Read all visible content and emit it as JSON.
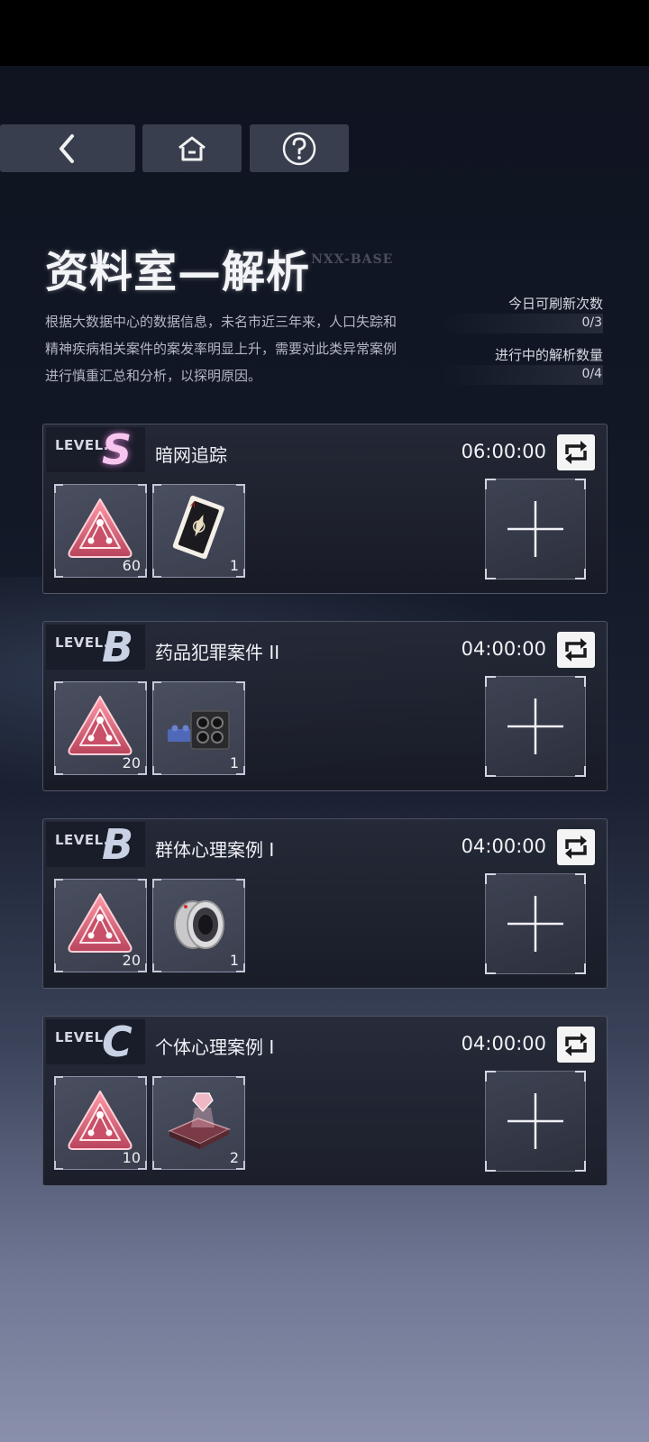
{
  "header": {
    "back_icon": "chevron-left-icon",
    "home_icon": "home-icon",
    "help_icon": "question-icon"
  },
  "page": {
    "title": "资料室—解析",
    "tag": "NXX-BASE",
    "description": "根据大数据中心的数据信息，未名市近三年来，人口失踪和精神疾病相关案件的案发率明显上升，需要对此类异常案例进行慎重汇总和分析，以探明原因。"
  },
  "stats": {
    "refresh_label": "今日可刷新次数",
    "refresh_value": "0/3",
    "active_label": "进行中的解析数量",
    "active_value": "0/4"
  },
  "cases": [
    {
      "level_word": "LEVEL.",
      "level": "S",
      "name": "暗网追踪",
      "time": "06:00:00",
      "items": [
        {
          "icon": "pink-triangle-token-icon",
          "count": "60"
        },
        {
          "icon": "playing-card-icon",
          "count": "1"
        }
      ]
    },
    {
      "level_word": "LEVEL.",
      "level": "B",
      "name": "药品犯罪案件 II",
      "time": "04:00:00",
      "items": [
        {
          "icon": "pink-triangle-token-icon",
          "count": "20"
        },
        {
          "icon": "building-block-icon",
          "count": "1"
        }
      ]
    },
    {
      "level_word": "LEVEL.",
      "level": "B",
      "name": "群体心理案例 I",
      "time": "04:00:00",
      "items": [
        {
          "icon": "pink-triangle-token-icon",
          "count": "20"
        },
        {
          "icon": "camera-lens-icon",
          "count": "1"
        }
      ]
    },
    {
      "level_word": "LEVEL.",
      "level": "C",
      "name": "个体心理案例 I",
      "time": "04:00:00",
      "items": [
        {
          "icon": "pink-triangle-token-icon",
          "count": "10"
        },
        {
          "icon": "hologram-tray-icon",
          "count": "2"
        }
      ]
    }
  ],
  "colors": {
    "accent_pink": "#f08ad8",
    "card_bg": "#262a38",
    "token_pink": "#e07a8c"
  }
}
